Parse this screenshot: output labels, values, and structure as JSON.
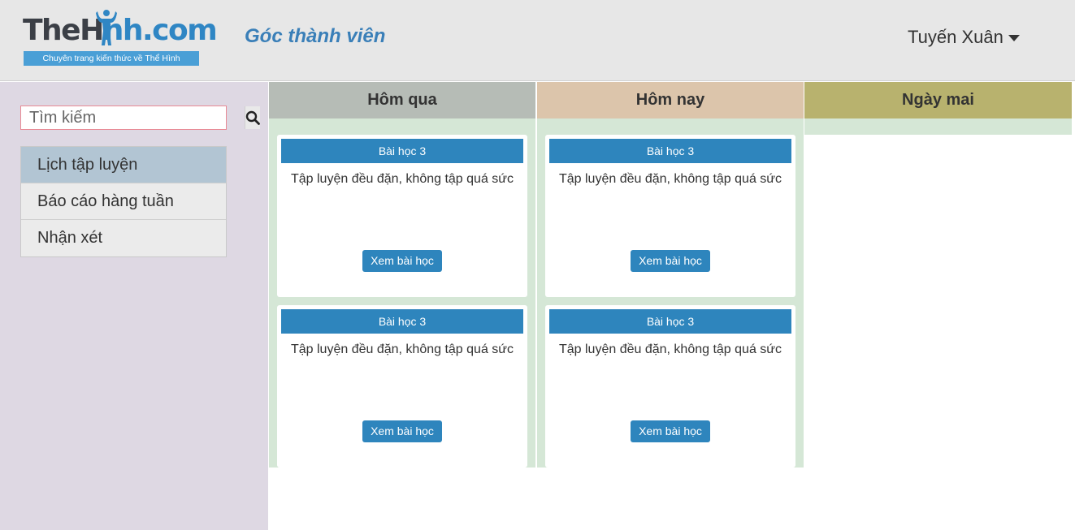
{
  "header": {
    "logo_text_part1": "TheH",
    "logo_text_part2": "nh.com",
    "logo_tagline": "Chuyên trang kiến thức về Thể Hình",
    "page_title": "Góc thành viên",
    "user_name": "Tuyến Xuân"
  },
  "sidebar": {
    "search_placeholder": "Tìm kiếm",
    "items": [
      {
        "label": "Lịch tập luyện",
        "active": true
      },
      {
        "label": "Báo cáo hàng tuần",
        "active": false
      },
      {
        "label": "Nhận xét",
        "active": false
      }
    ]
  },
  "columns": [
    {
      "title": "Hôm qua",
      "color": "#b6bcb6",
      "cards": [
        {
          "title": "Bài học 3",
          "description": "Tập luyện đều đặn, không tập quá sức",
          "button": "Xem bài học"
        },
        {
          "title": "Bài học 3",
          "description": "Tập luyện đều đặn, không tập quá sức",
          "button": "Xem bài học"
        }
      ]
    },
    {
      "title": "Hôm nay",
      "color": "#dcc5ab",
      "cards": [
        {
          "title": "Bài học 3",
          "description": "Tập luyện đều đặn, không tập quá sức",
          "button": "Xem bài học"
        },
        {
          "title": "Bài học 3",
          "description": "Tập luyện đều đặn, không tập quá sức",
          "button": "Xem bài học"
        }
      ]
    },
    {
      "title": "Ngày mai",
      "color": "#b8b26e",
      "cards": []
    }
  ],
  "colors": {
    "header_bg": "#e7e7e7",
    "sidebar_bg": "#ded8e3",
    "column_body_bg": "#d5e7d6",
    "accent_blue": "#2e85bd",
    "active_nav_bg": "#b2c5d3"
  },
  "icons": {
    "search": "search-icon",
    "user_menu": "caret-down-icon"
  }
}
